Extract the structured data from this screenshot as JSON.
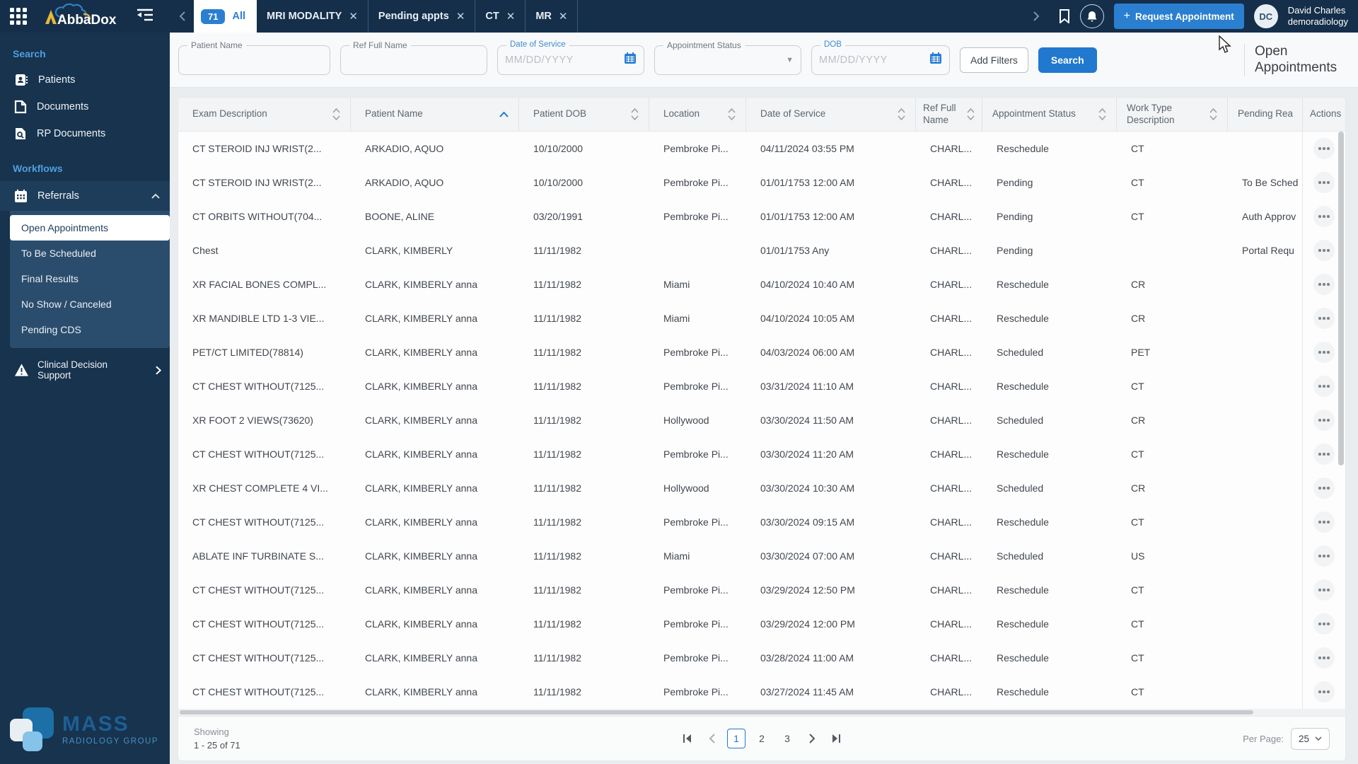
{
  "colors": {
    "accent": "#2178cf",
    "navy": "#152f4a",
    "submenu": "#2b4d6d",
    "active_item_bg": "#ffffff"
  },
  "topbar": {
    "logo_text": "AbbaDox",
    "count_badge": "71",
    "all_tab_label": "All",
    "tabs": [
      "MRI MODALITY",
      "Pending appts",
      "CT",
      "MR"
    ],
    "request_button_label": "Request Appointment",
    "user_initials": "DC",
    "user_name": "David Charles",
    "user_org": "demoradiology"
  },
  "sidebar": {
    "search_section_label": "Search",
    "search_items": [
      "Patients",
      "Documents",
      "RP Documents"
    ],
    "workflows_section_label": "Workflows",
    "referrals_label": "Referrals",
    "referral_items": [
      "Open Appointments",
      "To Be Scheduled",
      "Final Results",
      "No Show / Canceled",
      "Pending CDS"
    ],
    "active_item": "Open Appointments",
    "cds_label": "Clinical Decision Support",
    "logo_main": "MASS",
    "logo_sub": "RADIOLOGY GROUP"
  },
  "filters": {
    "patient_name_label": "Patient Name",
    "ref_full_name_label": "Ref Full Name",
    "date_of_service_label": "Date of Service",
    "date_placeholder": "MM/DD/YYYY",
    "appointment_status_label": "Appointment Status",
    "dob_label": "DOB",
    "add_filters_label": "Add Filters",
    "search_label": "Search",
    "page_title_line1": "Open",
    "page_title_line2": "Appointments"
  },
  "table": {
    "columns": [
      "Exam Description",
      "Patient Name",
      "Patient DOB",
      "Location",
      "Date of Service",
      "Ref Full Name",
      "Appointment Status",
      "Work Type Description",
      "Pending Rea",
      "Actions"
    ],
    "sorted_column": "Patient Name",
    "sort_direction": "asc",
    "rows": [
      {
        "exam": "CT STEROID INJ WRIST(2...",
        "patient": "ARKADIO, AQUO",
        "dob": "10/10/2000",
        "location": "Pembroke Pi...",
        "dos": "04/11/2024 03:55 PM",
        "ref": "CHARL...",
        "status": "Reschedule",
        "worktype": "CT",
        "pending": ""
      },
      {
        "exam": "CT STEROID INJ WRIST(2...",
        "patient": "ARKADIO, AQUO",
        "dob": "10/10/2000",
        "location": "Pembroke Pi...",
        "dos": "01/01/1753 12:00 AM",
        "ref": "CHARL...",
        "status": "Pending",
        "worktype": "CT",
        "pending": "To Be Sched"
      },
      {
        "exam": "CT ORBITS WITHOUT(704...",
        "patient": "BOONE, ALINE",
        "dob": "03/20/1991",
        "location": "Pembroke Pi...",
        "dos": "01/01/1753 12:00 AM",
        "ref": "CHARL...",
        "status": "Pending",
        "worktype": "CT",
        "pending": "Auth Approv"
      },
      {
        "exam": "Chest",
        "patient": "CLARK, KIMBERLY",
        "dob": "11/11/1982",
        "location": "",
        "dos": "01/01/1753 Any",
        "ref": "CHARL...",
        "status": "Pending",
        "worktype": "",
        "pending": "Portal Requ"
      },
      {
        "exam": "XR FACIAL BONES COMPL...",
        "patient": "CLARK, KIMBERLY anna",
        "dob": "11/11/1982",
        "location": "Miami",
        "dos": "04/10/2024 10:40 AM",
        "ref": "CHARL...",
        "status": "Reschedule",
        "worktype": "CR",
        "pending": ""
      },
      {
        "exam": "XR MANDIBLE LTD 1-3 VIE...",
        "patient": "CLARK, KIMBERLY anna",
        "dob": "11/11/1982",
        "location": "Miami",
        "dos": "04/10/2024 10:05 AM",
        "ref": "CHARL...",
        "status": "Reschedule",
        "worktype": "CR",
        "pending": ""
      },
      {
        "exam": "PET/CT LIMITED(78814)",
        "patient": "CLARK, KIMBERLY anna",
        "dob": "11/11/1982",
        "location": "Pembroke Pi...",
        "dos": "04/03/2024 06:00 AM",
        "ref": "CHARL...",
        "status": "Scheduled",
        "worktype": "PET",
        "pending": ""
      },
      {
        "exam": "CT CHEST WITHOUT(7125...",
        "patient": "CLARK, KIMBERLY anna",
        "dob": "11/11/1982",
        "location": "Pembroke Pi...",
        "dos": "03/31/2024 11:10 AM",
        "ref": "CHARL...",
        "status": "Reschedule",
        "worktype": "CT",
        "pending": ""
      },
      {
        "exam": "XR FOOT 2 VIEWS(73620)",
        "patient": "CLARK, KIMBERLY anna",
        "dob": "11/11/1982",
        "location": "Hollywood",
        "dos": "03/30/2024 11:50 AM",
        "ref": "CHARL...",
        "status": "Scheduled",
        "worktype": "CR",
        "pending": ""
      },
      {
        "exam": "CT CHEST WITHOUT(7125...",
        "patient": "CLARK, KIMBERLY anna",
        "dob": "11/11/1982",
        "location": "Pembroke Pi...",
        "dos": "03/30/2024 11:20 AM",
        "ref": "CHARL...",
        "status": "Reschedule",
        "worktype": "CT",
        "pending": ""
      },
      {
        "exam": "XR CHEST COMPLETE 4 VI...",
        "patient": "CLARK, KIMBERLY anna",
        "dob": "11/11/1982",
        "location": "Hollywood",
        "dos": "03/30/2024 10:30 AM",
        "ref": "CHARL...",
        "status": "Scheduled",
        "worktype": "CR",
        "pending": ""
      },
      {
        "exam": "CT CHEST WITHOUT(7125...",
        "patient": "CLARK, KIMBERLY anna",
        "dob": "11/11/1982",
        "location": "Pembroke Pi...",
        "dos": "03/30/2024 09:15 AM",
        "ref": "CHARL...",
        "status": "Reschedule",
        "worktype": "CT",
        "pending": ""
      },
      {
        "exam": "ABLATE INF TURBINATE S...",
        "patient": "CLARK, KIMBERLY anna",
        "dob": "11/11/1982",
        "location": "Miami",
        "dos": "03/30/2024 07:00 AM",
        "ref": "CHARL...",
        "status": "Scheduled",
        "worktype": "US",
        "pending": ""
      },
      {
        "exam": "CT CHEST WITHOUT(7125...",
        "patient": "CLARK, KIMBERLY anna",
        "dob": "11/11/1982",
        "location": "Pembroke Pi...",
        "dos": "03/29/2024 12:50 PM",
        "ref": "CHARL...",
        "status": "Reschedule",
        "worktype": "CT",
        "pending": ""
      },
      {
        "exam": "CT CHEST WITHOUT(7125...",
        "patient": "CLARK, KIMBERLY anna",
        "dob": "11/11/1982",
        "location": "Pembroke Pi...",
        "dos": "03/29/2024 12:00 PM",
        "ref": "CHARL...",
        "status": "Reschedule",
        "worktype": "CT",
        "pending": ""
      },
      {
        "exam": "CT CHEST WITHOUT(7125...",
        "patient": "CLARK, KIMBERLY anna",
        "dob": "11/11/1982",
        "location": "Pembroke Pi...",
        "dos": "03/28/2024 11:00 AM",
        "ref": "CHARL...",
        "status": "Reschedule",
        "worktype": "CT",
        "pending": ""
      },
      {
        "exam": "CT CHEST WITHOUT(7125...",
        "patient": "CLARK, KIMBERLY anna",
        "dob": "11/11/1982",
        "location": "Pembroke Pi...",
        "dos": "03/27/2024 11:45 AM",
        "ref": "CHARL...",
        "status": "Reschedule",
        "worktype": "CT",
        "pending": ""
      }
    ]
  },
  "pagination": {
    "showing_label": "Showing",
    "showing_range": "1 - 25 of 71",
    "pages": [
      "1",
      "2",
      "3"
    ],
    "current_page": "1",
    "per_page_label": "Per Page:",
    "per_page_value": "25"
  }
}
